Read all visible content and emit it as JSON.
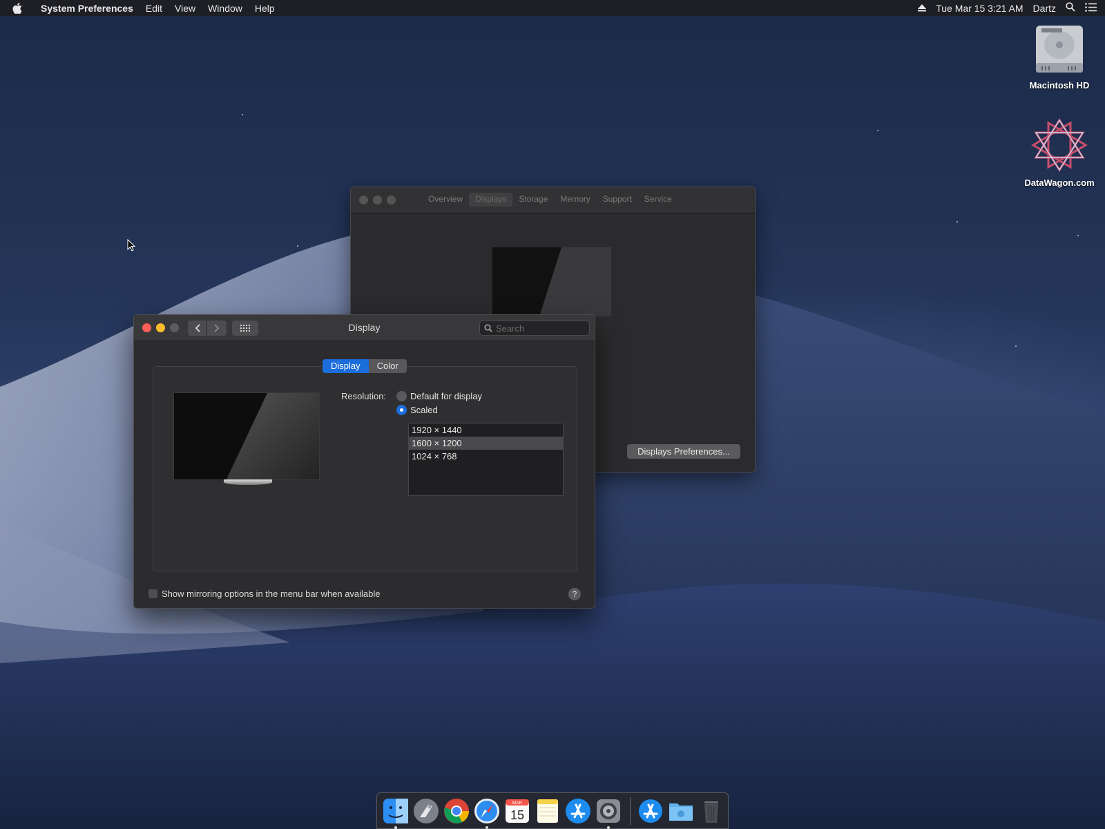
{
  "menubar": {
    "app_name": "System Preferences",
    "menus": [
      "Edit",
      "View",
      "Window",
      "Help"
    ],
    "datetime": "Tue Mar 15  3:21 AM",
    "user": "Dartz"
  },
  "desktop": {
    "icons": [
      {
        "label": "Macintosh HD",
        "icon": "hard-drive-icon"
      },
      {
        "label": "DataWagon.com",
        "icon": "datawagon-logo-icon"
      }
    ]
  },
  "back_window": {
    "tabs": [
      "Overview",
      "Displays",
      "Storage",
      "Memory",
      "Support",
      "Service"
    ],
    "active_tab": "Displays",
    "button_label": "Displays Preferences..."
  },
  "display_window": {
    "title": "Display",
    "search_placeholder": "Search",
    "segments": [
      "Display",
      "Color"
    ],
    "active_segment": "Display",
    "resolution_label": "Resolution:",
    "radio_options": [
      {
        "label": "Default for display",
        "selected": false
      },
      {
        "label": "Scaled",
        "selected": true
      }
    ],
    "resolutions": [
      "1920 × 1440",
      "1600 × 1200",
      "1024 × 768"
    ],
    "selected_resolution": "1600 × 1200",
    "mirroring_label": "Show mirroring options in the menu bar when available",
    "mirroring_checked": false,
    "help_label": "?"
  },
  "dock": {
    "items": [
      "finder-icon",
      "launchpad-icon",
      "chrome-icon",
      "safari-icon",
      "calendar-icon",
      "notes-icon",
      "app-store-icon",
      "system-preferences-icon",
      "app-store-folder-icon",
      "downloads-folder-icon",
      "trash-icon"
    ],
    "calendar_month": "MAR",
    "calendar_day": "15"
  },
  "colors": {
    "accent": "#1c6ddc",
    "close": "#ff5f57",
    "minimize": "#febc2e"
  }
}
